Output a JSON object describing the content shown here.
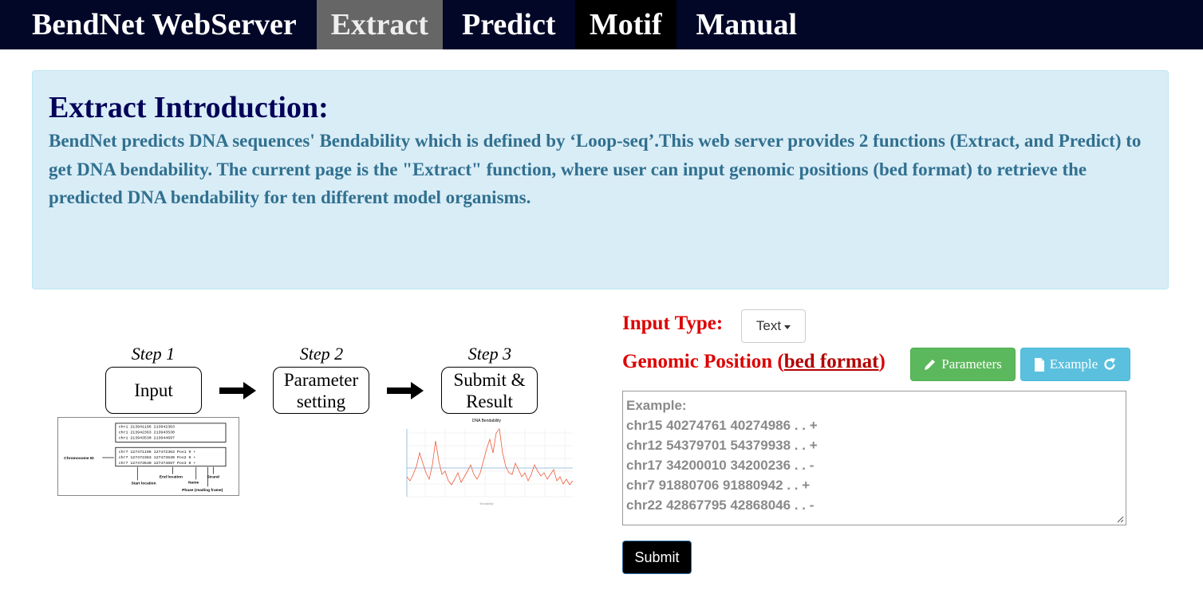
{
  "nav": {
    "brand": "BendNet WebServer",
    "items": [
      "Extract",
      "Predict",
      "Motif",
      "Manual"
    ]
  },
  "intro": {
    "title": "Extract Introduction:",
    "body": "BendNet predicts DNA sequences' Bendability which is defined by ‘Loop-seq’.This web server provides 2 functions (Extract, and Predict) to get DNA bendability. The current page is the \"Extract\" function, where user can input genomic positions (bed format) to retrieve the predicted DNA bendability for ten different model organisms."
  },
  "workflow": {
    "steps": [
      {
        "label": "Step 1",
        "box": "Input"
      },
      {
        "label": "Step 2",
        "box_line1": "Parameter",
        "box_line2": "setting"
      },
      {
        "label": "Step 3",
        "box_line1": "Submit &",
        "box_line2": "Result"
      }
    ],
    "bed_example": {
      "top_rows": [
        "chr1   213941196   213942363",
        "chr1   213942363   213943530",
        "chr1   213943530   213944697"
      ],
      "bottom_rows": [
        "chr7   127471196   127472363   Pos1   0   +",
        "chr7   127472363   127473530   Pos2   0   +",
        "chr7   127473530   127474697   Pos3   0   +"
      ],
      "annotations": {
        "chromosome": "Chromosome ID",
        "start": "Start location",
        "end": "End location",
        "name": "Name",
        "strand": "Strand",
        "phase": "Phase (reading frame)"
      }
    },
    "result_chart_title": "DNA Bendability",
    "result_chart_legend": "Bendability"
  },
  "form": {
    "input_type_label": "Input Type:",
    "input_type_value": "Text",
    "genomic_label": "Genomic Position (",
    "genomic_link": "bed format",
    "genomic_close": ")",
    "params_button": "Parameters",
    "example_button": "Example",
    "textarea_lines": [
      "Example:",
      "chr15 40274761 40274986 . . +",
      "chr12 54379701 54379938 . . +",
      "chr17 34200010 34200236 . . -",
      "chr7 91880706 91880942 . . +",
      "chr22 42867795 42868046 . . -"
    ],
    "submit": "Submit"
  },
  "colors": {
    "nav_bg": "#020728",
    "nav_active": "#666666",
    "intro_bg": "#d9edf7",
    "label_red": "#dd0000",
    "params_green": "#5cb85c",
    "example_blue": "#5bc0de"
  }
}
